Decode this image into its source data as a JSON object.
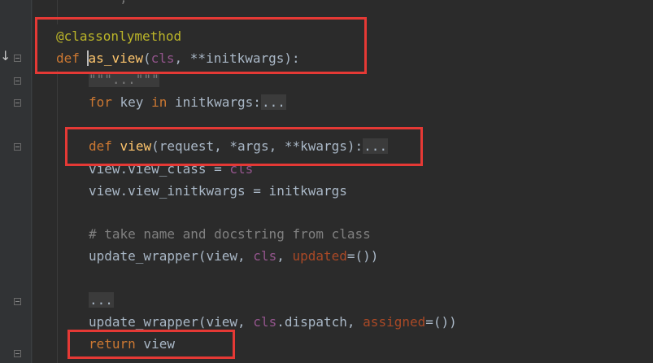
{
  "editor": {
    "lines": {
      "top_fragment": "  ·  ·  ,  ·  ·  ·",
      "decorator": "@classonlymethod",
      "def_kw": "def",
      "as_view_name": "as_view",
      "as_view_open": "(",
      "as_view_cls": "cls",
      "as_view_rest": ", **initkwargs):",
      "docstring_fold": "\"\"\"...\"\"\"",
      "for_kw": "for",
      "for_var": " key ",
      "in_kw": "in",
      "for_rest": " initkwargs:",
      "fold_dots": "...",
      "view_def_kw": "def",
      "view_name": "view",
      "view_args": "(request, *args, **kwargs):",
      "view_class_lhs": "view.view_class = ",
      "view_class_rhs": "cls",
      "view_initkwargs": "view.view_initkwargs = initkwargs",
      "comment": "# take name and docstring from class",
      "uw1_start": "update_wrapper(view, ",
      "uw1_cls": "cls",
      "uw1_sep": ", ",
      "uw1_named": "updated",
      "uw1_end": "=())",
      "ellipsis_fold": "...",
      "uw2_start": "update_wrapper(view, ",
      "uw2_cls": "cls",
      "uw2_mid": ".dispatch, ",
      "uw2_named": "assigned",
      "uw2_end": "=())",
      "return_kw": "return",
      "return_val": " view"
    }
  }
}
